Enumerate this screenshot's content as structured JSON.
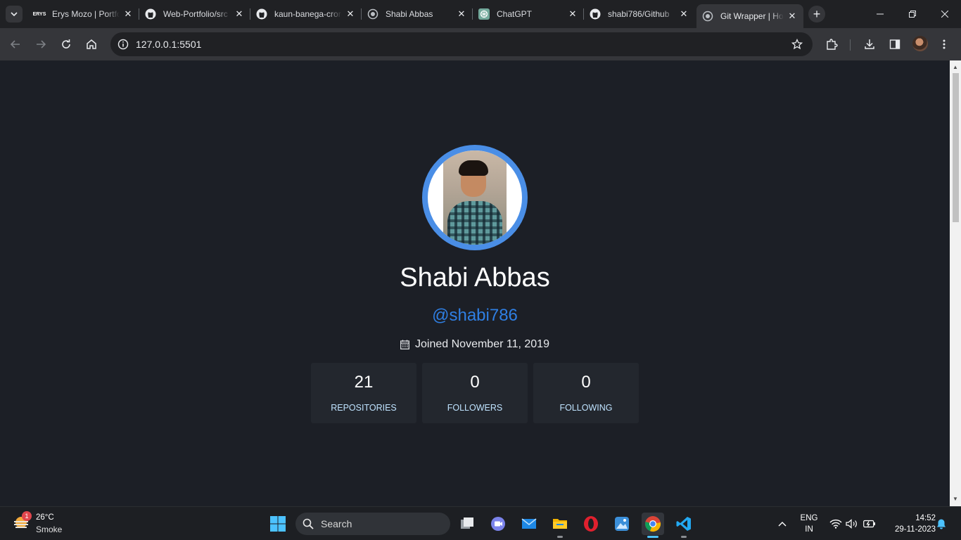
{
  "browser": {
    "tabs": [
      {
        "title": "Erys Mozo | Portfolio",
        "favicon": "erys-logo-icon"
      },
      {
        "title": "Web-Portfolio/src",
        "favicon": "github-icon"
      },
      {
        "title": "kaun-banega-crorepati",
        "favicon": "github-icon"
      },
      {
        "title": "Shabi Abbas",
        "favicon": "globe-icon"
      },
      {
        "title": "ChatGPT",
        "favicon": "chatgpt-icon"
      },
      {
        "title": "shabi786/Github",
        "favicon": "github-icon"
      },
      {
        "title": "Git Wrapper | Home",
        "favicon": "globe-icon",
        "active": true
      }
    ],
    "url": "127.0.0.1:5501",
    "favicon_text": "ERYS"
  },
  "profile": {
    "name": "Shabi Abbas",
    "handle": "@shabi786",
    "joined": "Joined November 11, 2019",
    "avatar_ring_color": "#4a8ee6",
    "handle_color": "#2f7fe3"
  },
  "stats": [
    {
      "value": "21",
      "label": "REPOSITORIES"
    },
    {
      "value": "0",
      "label": "FOLLOWERS"
    },
    {
      "value": "0",
      "label": "FOLLOWING"
    }
  ],
  "taskbar": {
    "weather": {
      "temp": "26°C",
      "desc": "Smoke",
      "badge": "1"
    },
    "search_label": "Search",
    "lang_line1": "ENG",
    "lang_line2": "IN",
    "time": "14:52",
    "date": "29-11-2023"
  }
}
